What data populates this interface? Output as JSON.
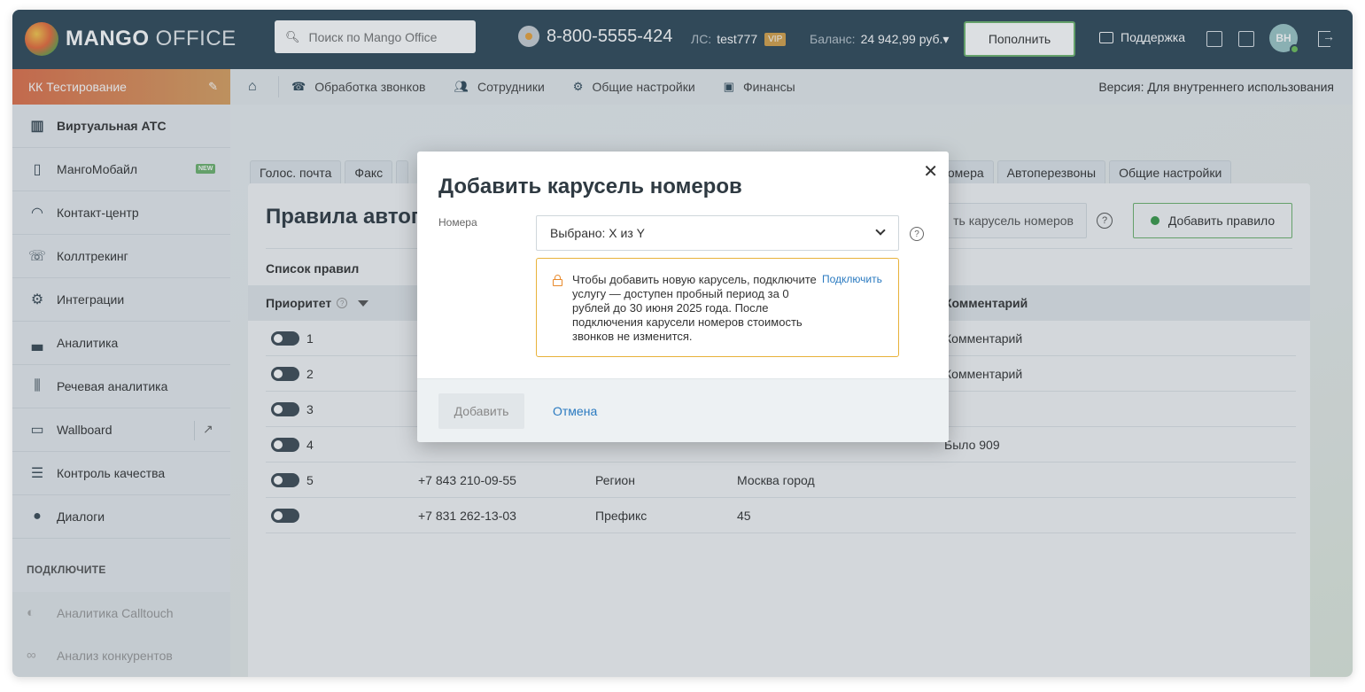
{
  "header": {
    "logo_bold": "MANGO",
    "logo_light": " OFFICE",
    "search_placeholder": "Поиск по Mango Office",
    "phone": "8-800-5555-424",
    "ls_label": "ЛС:",
    "ls_value": "test777",
    "vip": "VIP",
    "balance_label": "Баланс:",
    "balance_value": "24 942,99 руб.▾",
    "topup": "Пополнить",
    "support": "Поддержка",
    "avatar": "ВН"
  },
  "sidebar": {
    "account": "КК Тестирование",
    "items": [
      {
        "label": "Виртуальная АТС",
        "icon": "▥"
      },
      {
        "label": "МангоМобайл",
        "icon": "▯",
        "badge": "NEW"
      },
      {
        "label": "Контакт-центр",
        "icon": "◠"
      },
      {
        "label": "Коллтрекинг",
        "icon": "☏"
      },
      {
        "label": "Интеграции",
        "icon": "⚙"
      },
      {
        "label": "Аналитика",
        "icon": "▃"
      },
      {
        "label": "Речевая аналитика",
        "icon": "⫼"
      },
      {
        "label": "Wallboard",
        "icon": "▭"
      },
      {
        "label": "Контроль качества",
        "icon": "☰"
      },
      {
        "label": "Диалоги",
        "icon": "●"
      }
    ],
    "section_head": "ПОДКЛЮЧИТЕ",
    "extras": [
      {
        "label": "Аналитика Calltouch",
        "icon": "◐"
      },
      {
        "label": "Анализ конкурентов",
        "icon": "∞"
      }
    ]
  },
  "nav": {
    "items": [
      "Обработка звонков",
      "Сотрудники",
      "Общие настройки",
      "Финансы"
    ],
    "version": "Версия: Для внутреннего использования"
  },
  "tabs": [
    "Голос. почта",
    "Факс",
    "",
    "номера",
    "Автоперезвоны",
    "Общие настройки"
  ],
  "panel": {
    "title": "Правила автоп",
    "btn_carousel": "ть карусель номеров",
    "btn_add_rule": "Добавить правило",
    "rules_list": "Список правил",
    "col_priority": "Приоритет",
    "col_comment": "Комментарий",
    "rows": [
      {
        "prio": "1",
        "phone": "",
        "type": "",
        "value": "",
        "comment": "Комментарий"
      },
      {
        "prio": "2",
        "phone": "",
        "type": "",
        "value": "",
        "comment": "Комментарий"
      },
      {
        "prio": "3",
        "phone": "",
        "type": "",
        "value": "",
        "comment": ""
      },
      {
        "prio": "4",
        "phone": "",
        "type": "",
        "value": "",
        "comment": "Было 909"
      },
      {
        "prio": "5",
        "phone": "+7 843 210-09-55",
        "type": "Регион",
        "value": "Москва город",
        "comment": ""
      },
      {
        "prio": "",
        "phone": "+7 831 262-13-03",
        "type": "Префикс",
        "value": "45",
        "comment": ""
      }
    ]
  },
  "modal": {
    "title": "Добавить карусель номеров",
    "label": "Номера",
    "selected": "Выбрано: X из Y",
    "warning": "Чтобы добавить новую карусель, подключите услугу — доступен пробный период за 0 рублей до 30 июня 2025 года. После подключения карусели номеров стоимость звонков не изменится.",
    "connect": "Подключить",
    "add": "Добавить",
    "cancel": "Отмена"
  }
}
